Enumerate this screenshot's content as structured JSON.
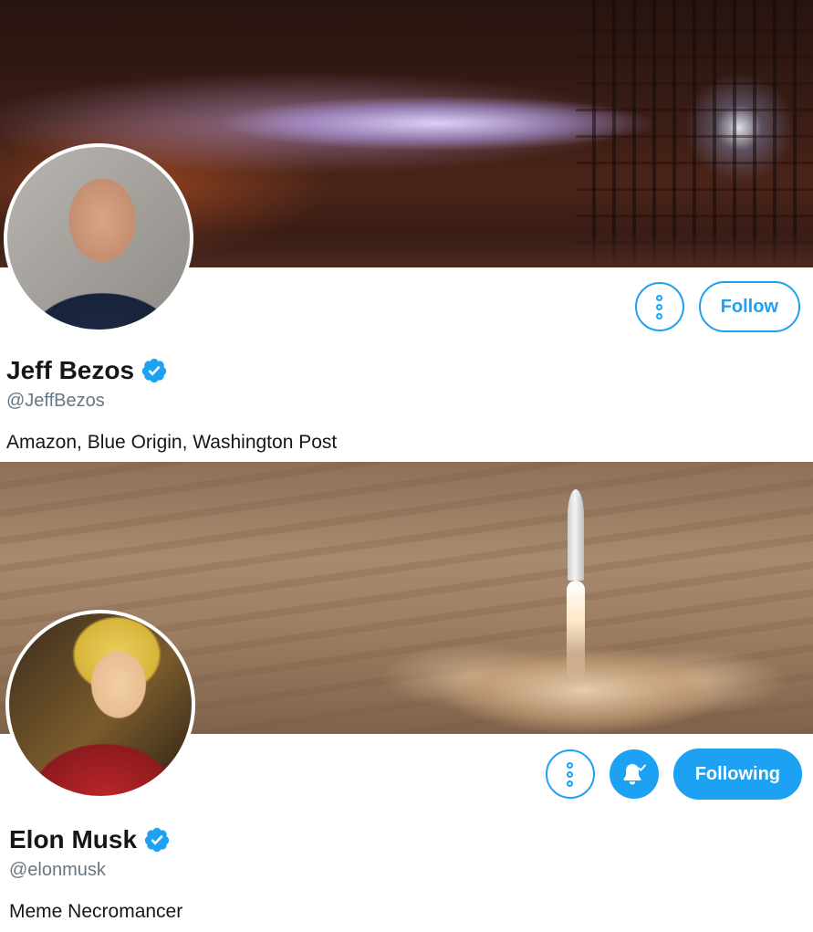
{
  "profiles": [
    {
      "name": "Jeff Bezos",
      "handle": "@JeffBezos",
      "bio": "Amazon, Blue Origin, Washington Post",
      "verified": true,
      "more_icon": "more-vertical-icon",
      "follow_label": "Follow",
      "banner_scene": "rocket engine test fire",
      "avatar_icon": "profile-photo"
    },
    {
      "name": "Elon Musk",
      "handle": "@elonmusk",
      "bio": "Meme Necromancer",
      "verified": true,
      "more_icon": "more-vertical-icon",
      "notification_icon": "bell-check-icon",
      "follow_label": "Following",
      "banner_scene": "rocket launch on mars",
      "avatar_icon": "profile-photo"
    }
  ],
  "colors": {
    "accent": "#1da1f2",
    "text_primary": "#14171a",
    "text_secondary": "#657786",
    "background": "#ffffff"
  }
}
